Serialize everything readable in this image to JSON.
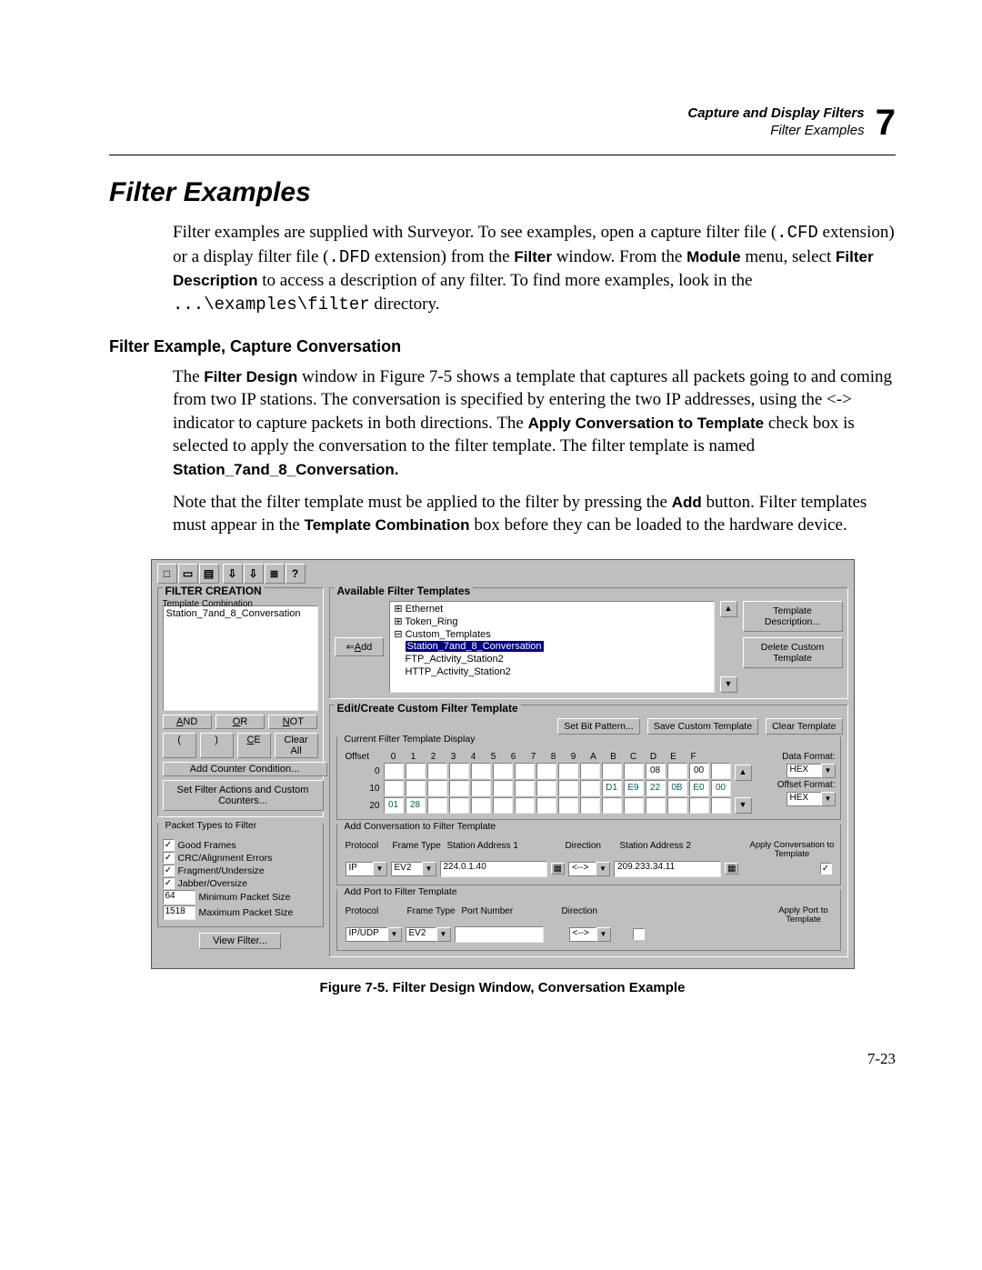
{
  "running_head": {
    "chapter_title": "Capture and Display Filters",
    "section_title": "Filter Examples",
    "chapter_number": "7"
  },
  "h1": "Filter Examples",
  "p1_a": "Filter examples are supplied with Surveyor. To see examples, open a capture filter file (",
  "p1_ext1": ".CFD",
  "p1_b": " extension) or a display filter file (",
  "p1_ext2": ".DFD",
  "p1_c": " extension) from the ",
  "p1_filter": "Filter",
  "p1_d": " window. From the ",
  "p1_module": "Module",
  "p1_e": " menu, select ",
  "p1_fdesc": "Filter Description",
  "p1_f": " to access a description of any filter. To find more examples, look in the ",
  "p1_path": "...\\examples\\filter",
  "p1_g": " directory.",
  "subhead": "Filter Example, Capture Conversation",
  "p2_a": "The ",
  "p2_fd": "Filter Design",
  "p2_b": " window in Figure 7-5 shows a template that captures all packets going to and coming from two IP stations. The conversation is specified by entering the two IP addresses, using the <-> indicator to capture packets in both directions. The ",
  "p2_apply": "Apply Conversation to Template",
  "p2_c": " check box is selected to apply the conversation to the filter template. The filter template is named ",
  "p2_name": "Station_7and_8_Conversation.",
  "p3_a": "Note that the filter template must be applied to the filter by pressing the ",
  "p3_add": "Add",
  "p3_b": " button. Filter templates must appear in the ",
  "p3_tc": "Template Combination",
  "p3_c": " box before they can be loaded to the hardware device.",
  "figcap": "Figure 7-5. Filter Design Window, Conversation Example",
  "pagenum": "7-23",
  "toolbar_icons": [
    "□",
    "▭",
    "▤",
    "⇩",
    "⇩",
    "≣",
    "?"
  ],
  "filter_creation": {
    "title": "FILTER CREATION",
    "tc_label": "Template Combination",
    "tc_value": "Station_7and_8_Conversation",
    "and": "AND",
    "or": "OR",
    "not": "NOT",
    "lp": "(",
    "rp": ")",
    "ce": "CE",
    "clear_all": "Clear All",
    "add_counter": "Add Counter Condition...",
    "set_actions": "Set Filter Actions and Custom Counters..."
  },
  "packet_types": {
    "title": "Packet Types to Filter",
    "good": "Good Frames",
    "crc": "CRC/Alignment Errors",
    "frag": "Fragment/Undersize",
    "jab": "Jabber/Oversize",
    "min_lbl": "Minimum Packet Size",
    "min_val": "64",
    "max_lbl": "Maximum Packet Size",
    "max_val": "1518"
  },
  "view_filter": "View Filter...",
  "avail": {
    "title": "Available Filter Templates",
    "add": "Add",
    "tree": {
      "eth": "Ethernet",
      "tr": "Token_Ring",
      "ct": "Custom_Templates",
      "sel": "Station_7and_8_Conversation",
      "ftp": "FTP_Activity_Station2",
      "http": "HTTP_Activity_Station2"
    },
    "btn1": "Template Description...",
    "btn2": "Delete Custom Template"
  },
  "edit": {
    "title": "Edit/Create Custom Filter Template",
    "set_bit": "Set Bit Pattern...",
    "save": "Save Custom Template",
    "clear": "Clear Template",
    "disp_label": "Current Filter Template Display",
    "offset_lbl": "Offset",
    "cols": [
      "0",
      "1",
      "2",
      "3",
      "4",
      "5",
      "6",
      "7",
      "8",
      "9",
      "A",
      "B",
      "C",
      "D",
      "E",
      "F"
    ],
    "row0_off": "0",
    "row0_vals": [
      "",
      "",
      "",
      "",
      "",
      "",
      "",
      "",
      "",
      "",
      "",
      "",
      "08",
      "",
      "00",
      ""
    ],
    "row1_off": "10",
    "row1_vals": [
      "",
      "",
      "",
      "",
      "",
      "",
      "",
      "",
      "",
      "",
      "D1",
      "E9",
      "22",
      "0B",
      "E0",
      "00"
    ],
    "row2_off": "20",
    "row2_vals": [
      "01",
      "28"
    ],
    "data_fmt_lbl": "Data Format:",
    "offset_fmt_lbl": "Offset Format:",
    "fmt_val": "HEX"
  },
  "conv": {
    "title": "Add Conversation to Filter Template",
    "proto_h": "Protocol",
    "ft_h": "Frame Type",
    "sa1_h": "Station Address 1",
    "dir_h": "Direction",
    "sa2_h": "Station Address 2",
    "proto": "IP",
    "ft": "EV2",
    "sa1": "224.0.1.40",
    "dir": "<-->",
    "sa2": "209.233.34.11",
    "apply_lbl": "Apply Conversation to Template"
  },
  "port": {
    "title": "Add Port to Filter Template",
    "proto_h": "Protocol",
    "ft_h": "Frame Type",
    "pn_h": "Port Number",
    "dir_h": "Direction",
    "proto": "IP/UDP",
    "ft": "EV2",
    "dir": "<-->",
    "apply_lbl": "Apply Port to Template"
  }
}
